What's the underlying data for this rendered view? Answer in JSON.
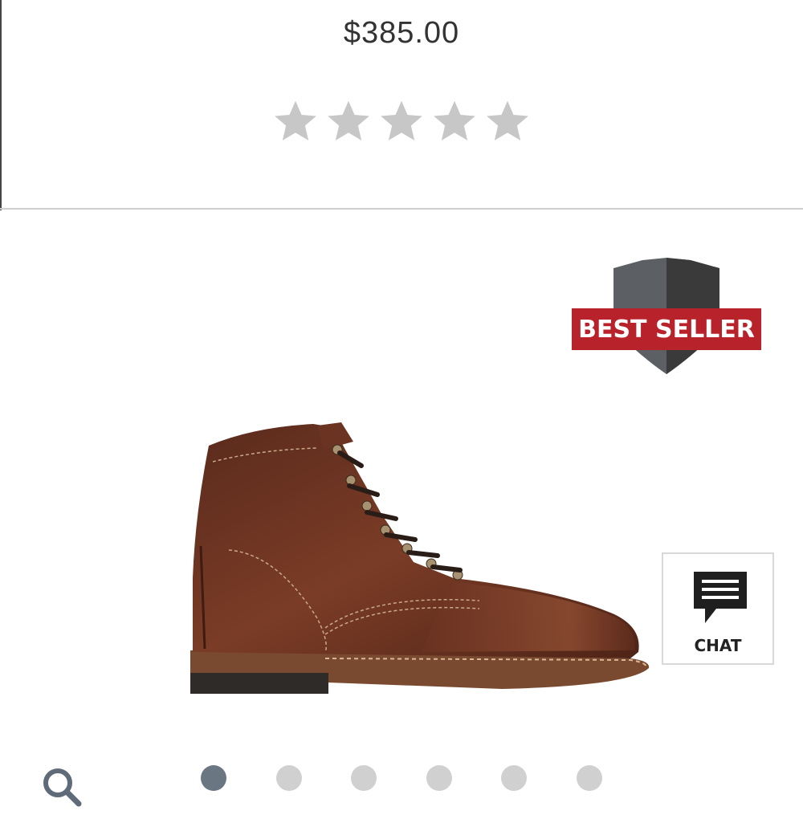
{
  "product": {
    "price": "$385.00",
    "rating": {
      "value": 0,
      "max": 5
    }
  },
  "badge": {
    "label": "BEST SELLER"
  },
  "chat": {
    "label": "CHAT"
  },
  "carousel": {
    "count": 6,
    "active_index": 0
  },
  "icons": {
    "rating": "star-icon",
    "zoom": "magnifier-icon",
    "chat": "speech-bubble-icon",
    "badge": "shield-icon"
  },
  "colors": {
    "star_empty": "#c7c7c7",
    "badge_red": "#b8232b",
    "badge_shield_dark": "#3a3a3a",
    "badge_shield_mid": "#5c5f63",
    "dot_active": "#6b7683",
    "dot_inactive": "#d0d0d0",
    "leather": "#6b3422"
  }
}
